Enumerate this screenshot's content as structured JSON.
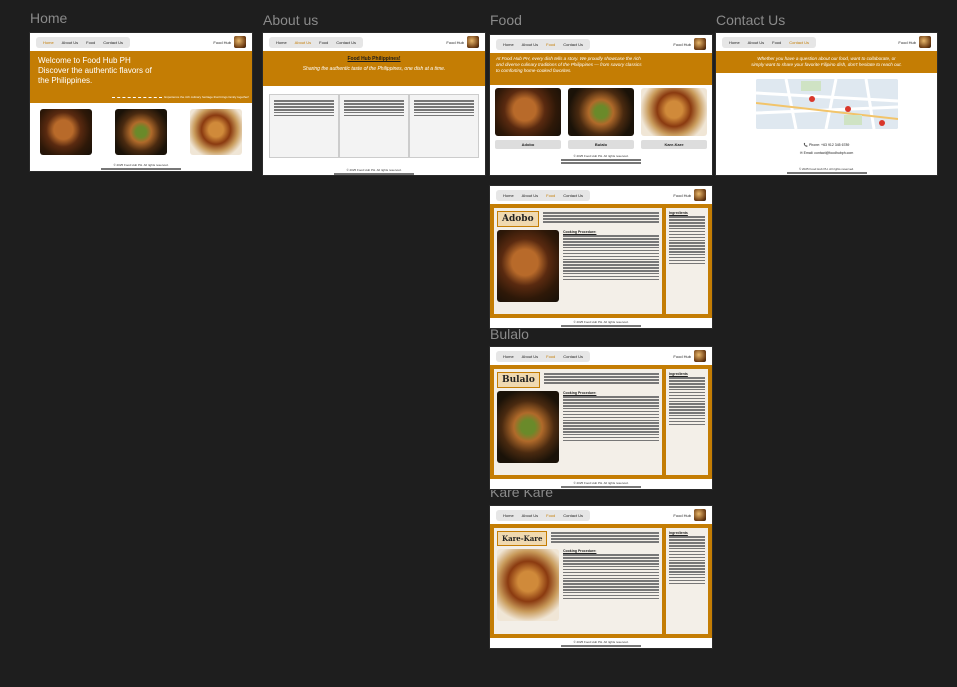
{
  "frames": {
    "home": "Home",
    "about": "About us",
    "food": "Food",
    "contact": "Contact Us",
    "adobo": "Adobo",
    "bulalo": "Bulalo",
    "kare": "Kare Kare"
  },
  "nav": {
    "home": "Home",
    "about": "About Us",
    "food": "Food",
    "contact": "Contact Us",
    "brand": "Food Hub"
  },
  "home": {
    "headline_1": "Welcome to Food Hub PH",
    "headline_2": "Discover the authentic flavors of",
    "headline_3": "the Philippines.",
    "tagline": "Experience the rich culinary heritage that brings family together!"
  },
  "about": {
    "title": "Food Hub Philippines!",
    "subtitle": "Sharing the authentic taste of the Philippines, one dish at a time."
  },
  "food": {
    "intro_1": "At Food Hub PH, every dish tells a story. We proudly showcase the rich",
    "intro_2": "and diverse culinary traditions of the Philippines — from savory classics",
    "intro_3": "to comforting home-cooked favorites.",
    "dish_1": "Adobo",
    "dish_2": "Bulalo",
    "dish_3": "Kare-Kare"
  },
  "contact": {
    "intro_1": "Whether you have a question about our food, want to collaborate, or",
    "intro_2": "simply want to share your favorite Filipino dish, don't hesitate to reach out.",
    "phone": "📞 Phone: +63 912 345 6789",
    "email": "✉ Email: contact@foodhubph.com"
  },
  "recipes": {
    "adobo_title": "Adobo",
    "bulalo_title": "Bulalo",
    "kare_title": "Kare-Kare",
    "procedure": "Cooking Procedure:",
    "ingredients": "Ingredients"
  },
  "footer": {
    "line1": "© 2025 Food Hub PH. All rights reserved."
  }
}
